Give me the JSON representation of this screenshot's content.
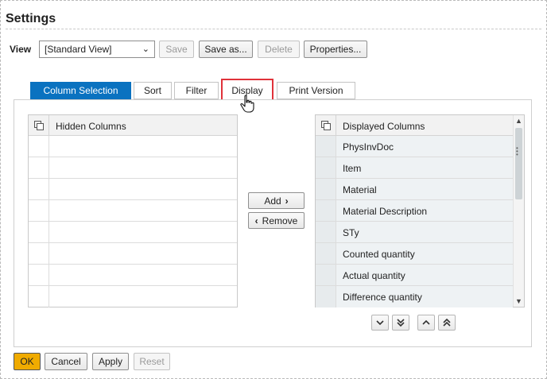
{
  "dialog": {
    "title": "Settings"
  },
  "view": {
    "label": "View",
    "selected": "[Standard View]",
    "buttons": {
      "save": "Save",
      "save_as": "Save as...",
      "delete": "Delete",
      "properties": "Properties..."
    }
  },
  "tabs": [
    {
      "label": "Column Selection",
      "active": true
    },
    {
      "label": "Sort",
      "active": false
    },
    {
      "label": "Filter",
      "active": false
    },
    {
      "label": "Display",
      "active": false,
      "highlighted": true
    },
    {
      "label": "Print Version",
      "active": false
    }
  ],
  "hidden_columns": {
    "header": "Hidden Columns",
    "rows": [
      "",
      "",
      "",
      "",
      "",
      "",
      "",
      ""
    ]
  },
  "displayed_columns": {
    "header": "Displayed Columns",
    "rows": [
      "PhysInvDoc",
      "Item",
      "Material",
      "Material Description",
      "STy",
      "Counted quantity",
      "Actual quantity",
      "Difference quantity"
    ]
  },
  "move_buttons": {
    "add": "Add",
    "remove": "Remove"
  },
  "footer": {
    "ok": "OK",
    "cancel": "Cancel",
    "apply": "Apply",
    "reset": "Reset"
  },
  "colors": {
    "accent": "#0a72c0",
    "ok": "#f0ab00",
    "highlight": "#e0323a"
  }
}
